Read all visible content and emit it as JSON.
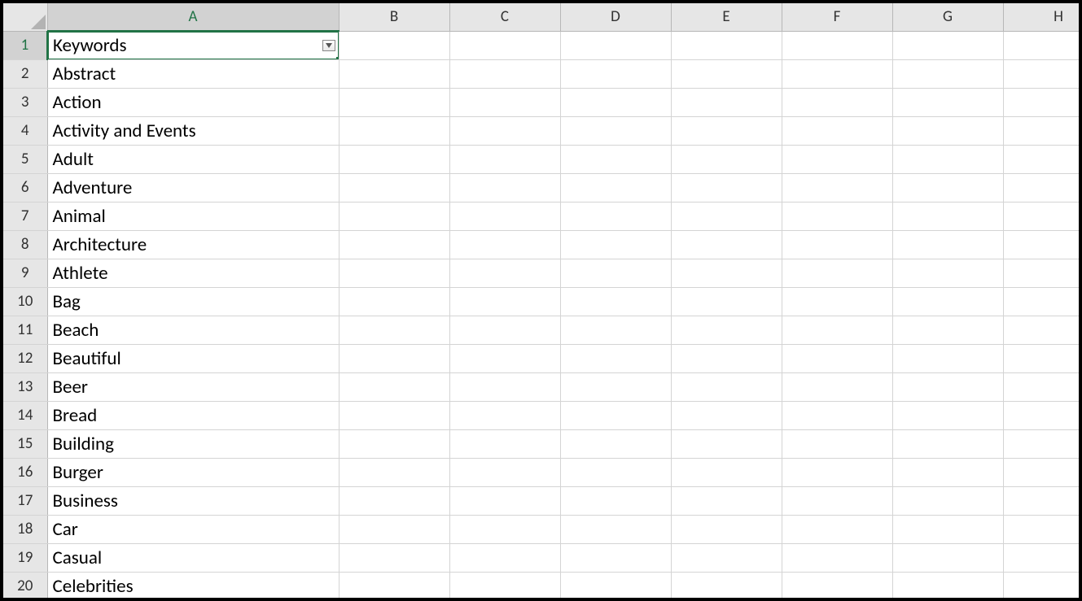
{
  "columns": [
    "A",
    "B",
    "C",
    "D",
    "E",
    "F",
    "G",
    "H"
  ],
  "active_column_index": 0,
  "active_row_index": 0,
  "rows": [
    {
      "num": 1,
      "a": "Keywords"
    },
    {
      "num": 2,
      "a": "Abstract"
    },
    {
      "num": 3,
      "a": "Action"
    },
    {
      "num": 4,
      "a": "Activity and Events"
    },
    {
      "num": 5,
      "a": "Adult"
    },
    {
      "num": 6,
      "a": "Adventure"
    },
    {
      "num": 7,
      "a": "Animal"
    },
    {
      "num": 8,
      "a": "Architecture"
    },
    {
      "num": 9,
      "a": "Athlete"
    },
    {
      "num": 10,
      "a": "Bag"
    },
    {
      "num": 11,
      "a": "Beach"
    },
    {
      "num": 12,
      "a": "Beautiful"
    },
    {
      "num": 13,
      "a": "Beer"
    },
    {
      "num": 14,
      "a": "Bread"
    },
    {
      "num": 15,
      "a": "Building"
    },
    {
      "num": 16,
      "a": "Burger"
    },
    {
      "num": 17,
      "a": "Business"
    },
    {
      "num": 18,
      "a": "Car"
    },
    {
      "num": 19,
      "a": "Casual"
    },
    {
      "num": 20,
      "a": "Celebrities"
    }
  ],
  "selected_cell": "A1",
  "a1_has_filter_dropdown": true
}
